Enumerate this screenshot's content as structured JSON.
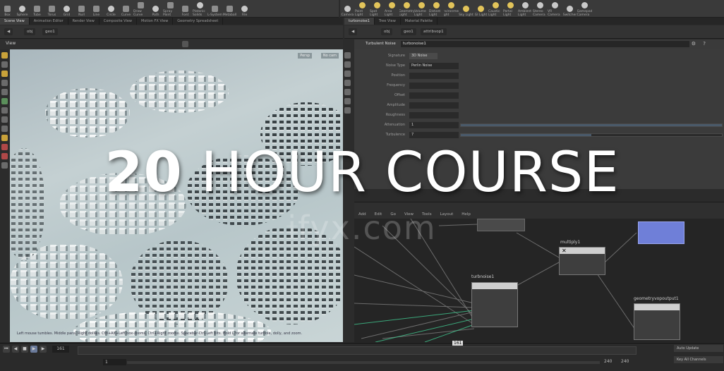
{
  "shelf_left_tools": [
    "Box",
    "Sphere",
    "Tube",
    "Torus",
    "Grid",
    "Null",
    "Line",
    "Circle",
    "Curve",
    "Draw Curve",
    "Path",
    "Spray Paint",
    "Font",
    "Platonic Solids",
    "L-System",
    "Metaball",
    "File"
  ],
  "shelf_right_tools": [
    "Camera",
    "Point Light",
    "Spot Light",
    "Area Light",
    "Geometry Light",
    "Volume Light",
    "Distant Light",
    "Environment Light",
    "Sky Light",
    "GI Light",
    "Caustic Light",
    "Portal Light",
    "Ambient Light",
    "Stereo Camera",
    "VR Camera",
    "Switcher",
    "Gamepad Camera"
  ],
  "tabs_left": [
    "Scene View",
    "Animation Editor",
    "Render View",
    "Composite View",
    "Motion FX View",
    "Geometry Spreadsheet"
  ],
  "tabs_right": [
    "turbonoise1",
    "Tree View",
    "Material Palette"
  ],
  "path_left": {
    "node": "obj",
    "geo": "geo1"
  },
  "path_right": {
    "node": "obj",
    "geo": "geo1",
    "sub": "attribvop1"
  },
  "viewport": {
    "label": "View",
    "persp_button": "Persp",
    "cam_button": "No cam"
  },
  "param": {
    "node_type": "Turbulent Noise",
    "node_name": "turbonoise1",
    "rows": [
      {
        "label": "Signature",
        "value": "3D Noise"
      },
      {
        "label": "Noise Type",
        "value": "Perlin Noise"
      },
      {
        "label": "Position",
        "value": ""
      },
      {
        "label": "Frequency",
        "value": ""
      },
      {
        "label": "Offset",
        "value": ""
      },
      {
        "label": "Amplitude",
        "value": ""
      },
      {
        "label": "Roughness",
        "value": ""
      },
      {
        "label": "Attenuation",
        "value": "1"
      },
      {
        "label": "Turbulence",
        "value": "7"
      }
    ],
    "turbulence_fill": 0.5
  },
  "network_menu": [
    "Add",
    "Edit",
    "Go",
    "View",
    "Tools",
    "Layout",
    "Help"
  ],
  "network_nodes": [
    "turbnoise1",
    "multiply1",
    "geometryvopoutput1"
  ],
  "status_text": "Left mouse tumbles. Middle pans. Right dollies. Ctrl+Alt+Left box-zooms. Ctrl+Right zooms. Spacebar-Ctrl-Left tilts. Hold L for alternate tumble, dolly, and zoom.",
  "timeline": {
    "current_frame": "161",
    "start": "1",
    "end": "240",
    "end2": "240",
    "marker": "161"
  },
  "right_buttons": [
    "Auto Update",
    "Key All Channels"
  ],
  "overlay_title_bold": "20",
  "overlay_title_rest": " HOUR COURSE",
  "watermark": "ifyx.com",
  "colors": {
    "accent_blue": "#6f7fd8",
    "wire_green": "#3fbf8a",
    "viewport_sky": "#b7c6c9"
  }
}
